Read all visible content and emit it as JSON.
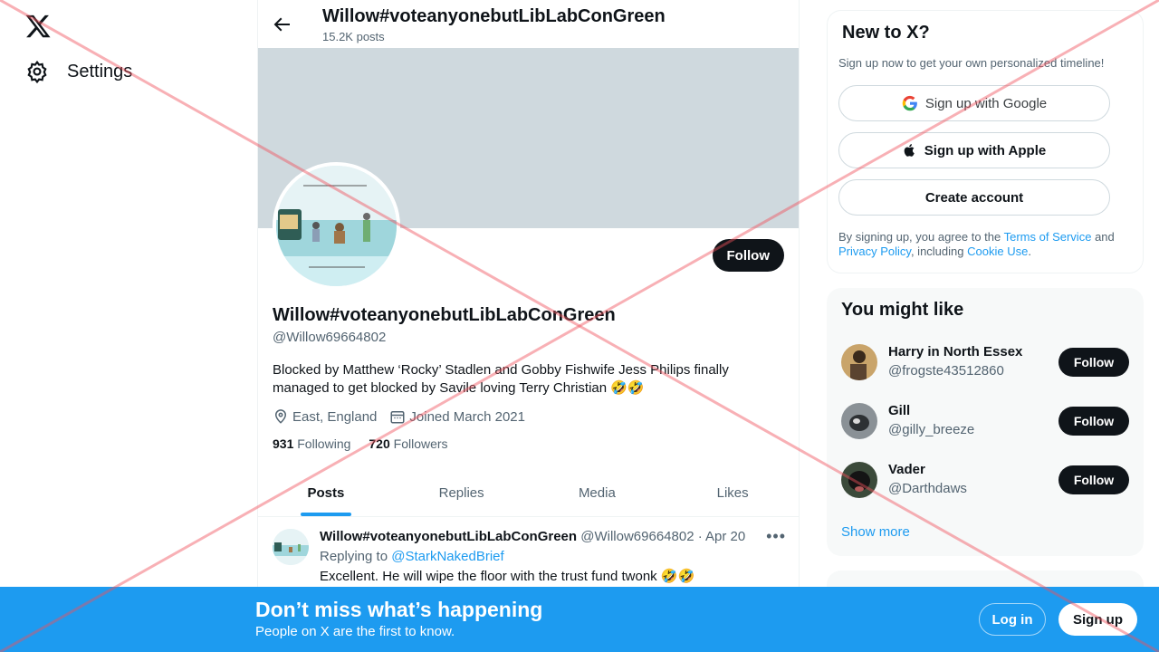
{
  "nav": {
    "settings_label": "Settings"
  },
  "header": {
    "title": "Willow#voteanyonebutLibLabConGreen",
    "posts_count": "15.2K posts"
  },
  "profile": {
    "follow_label": "Follow",
    "display_name": "Willow#voteanyonebutLibLabConGreen",
    "handle": "@Willow69664802",
    "bio": "Blocked by Matthew ‘Rocky’ Stadlen and Gobby Fishwife Jess Philips finally managed to get blocked by Savile loving Terry Christian 🤣🤣",
    "location": "East, England",
    "joined": "Joined March 2021",
    "following_count": "931",
    "following_label": "Following",
    "followers_count": "720",
    "followers_label": "Followers"
  },
  "tabs": [
    {
      "label": "Posts"
    },
    {
      "label": "Replies"
    },
    {
      "label": "Media"
    },
    {
      "label": "Likes"
    }
  ],
  "post": {
    "author": "Willow#voteanyonebutLibLabConGreen",
    "handle_date": "@Willow69664802 · Apr 20",
    "replying_prefix": "Replying to",
    "replying_to": "@StarkNakedBrief",
    "text": "Excellent. He will wipe the floor with the trust fund twonk 🤣🤣"
  },
  "signup_card": {
    "title": "New to X?",
    "subtitle": "Sign up now to get your own personalized timeline!",
    "google_label": "Sign up with Google",
    "apple_label": "Sign up with Apple",
    "create_label": "Create account",
    "legal_prefix": "By signing up, you agree to the",
    "terms_link": "Terms of Service",
    "legal_and": "and",
    "privacy_link": "Privacy Policy",
    "legal_including": ", including",
    "cookie_link": "Cookie Use",
    "legal_end": "."
  },
  "suggestions": {
    "title": "You might like",
    "items": [
      {
        "name": "Harry in North Essex",
        "handle": "@frogste43512860",
        "follow": "Follow"
      },
      {
        "name": "Gill",
        "handle": "@gilly_breeze",
        "follow": "Follow"
      },
      {
        "name": "Vader",
        "handle": "@Darthdaws",
        "follow": "Follow"
      }
    ],
    "show_more": "Show more"
  },
  "bottom_bar": {
    "title": "Don’t miss what’s happening",
    "subtitle": "People on X are the first to know.",
    "login_label": "Log in",
    "signup_label": "Sign up"
  },
  "colors": {
    "accent": "#1d9bf0",
    "dark": "#0f1419",
    "muted": "#536471",
    "banner": "#cfd9de"
  }
}
